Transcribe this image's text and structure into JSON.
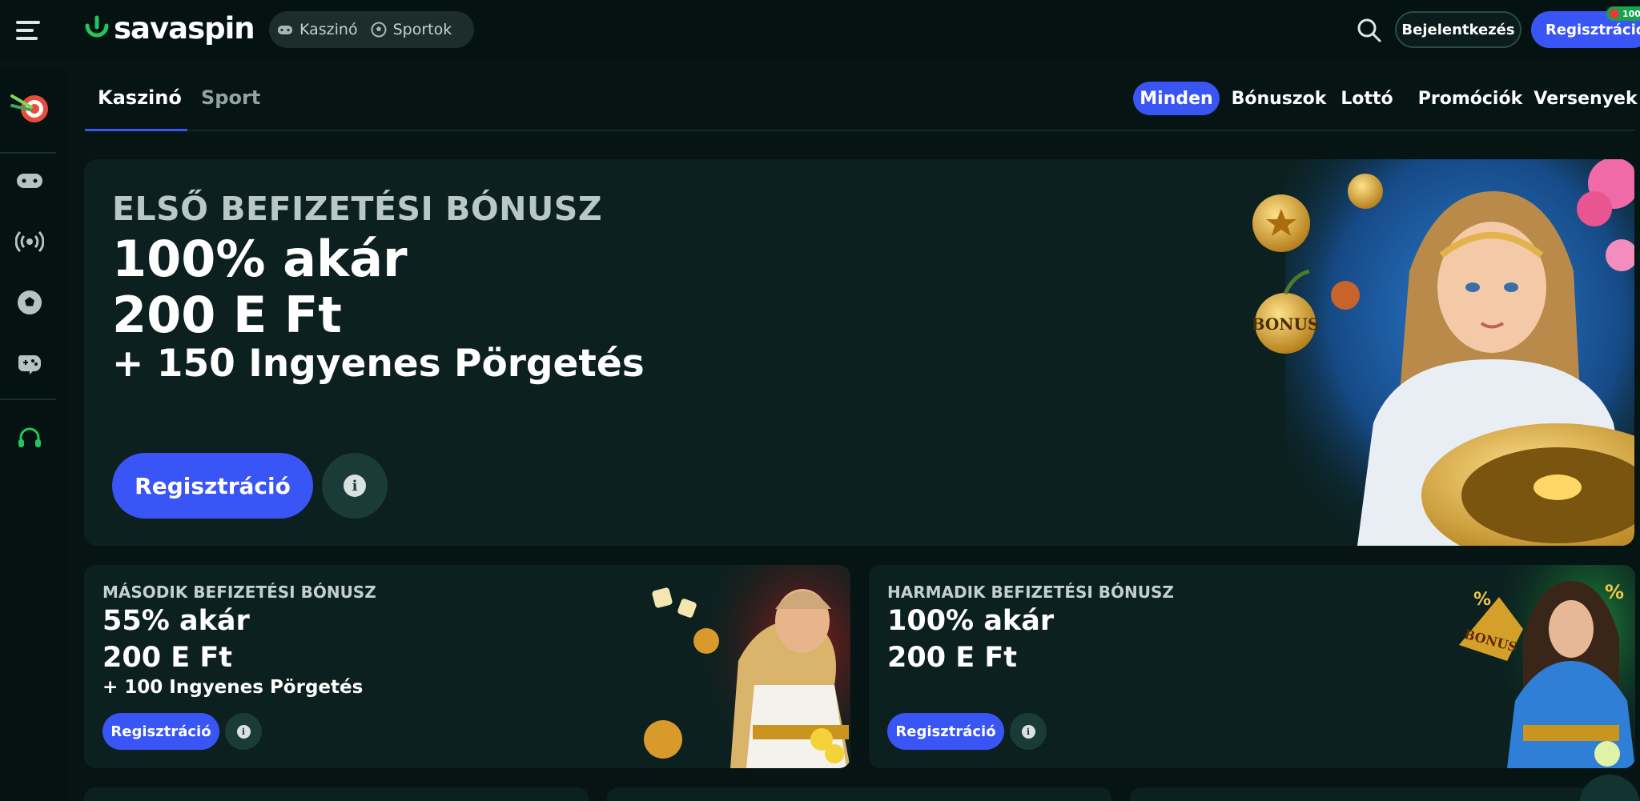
{
  "header": {
    "logo_text": "savaspin",
    "nav_pill": [
      {
        "label": "Kaszinó",
        "icon": "gamepad-icon"
      },
      {
        "label": "Sportok",
        "icon": "soccer-ball-icon"
      }
    ],
    "login_label": "Bejelentkezés",
    "register_label": "Regisztráció",
    "badge_text": "100"
  },
  "sidebar": {
    "items": [
      {
        "icon": "darts-target-icon"
      },
      {
        "icon": "gamepad-icon"
      },
      {
        "icon": "live-broadcast-icon"
      },
      {
        "icon": "soccer-ball-icon"
      },
      {
        "icon": "joystick-icon"
      },
      {
        "icon": "support-headset-icon"
      }
    ]
  },
  "subnav": {
    "tabs": [
      "Kaszinó",
      "Sport"
    ],
    "active_tab": "Kaszinó",
    "filters": [
      "Minden",
      "Bónuszok",
      "Lottó",
      "Promóciók",
      "Versenyek"
    ],
    "active_filter": "Minden"
  },
  "hero": {
    "pre_title": "ELSŐ BEFIZETÉSI BÓNUSZ",
    "line1": "100% akár",
    "line2": "200 E Ft",
    "line3": "+ 150 Ingyenes Pörgetés",
    "button": "Regisztráció",
    "apple_text": "BONUS"
  },
  "cards": [
    {
      "pre_title": "MÁSODIK BEFIZETÉSI BÓNUSZ",
      "line1": "55% akár",
      "line2": "200 E Ft",
      "line3": "+ 100 Ingyenes Pörgetés",
      "button": "Regisztráció"
    },
    {
      "pre_title": "HARMADIK BEFIZETÉSI BÓNUSZ",
      "line1": "100% akár",
      "line2": "200 E Ft",
      "line3": "",
      "button": "Regisztráció",
      "fan_text": "BONUS"
    }
  ],
  "colors": {
    "background": "#061514",
    "panel": "#0b201f",
    "accent": "#3a55f5",
    "logo_green": "#22c55e"
  }
}
